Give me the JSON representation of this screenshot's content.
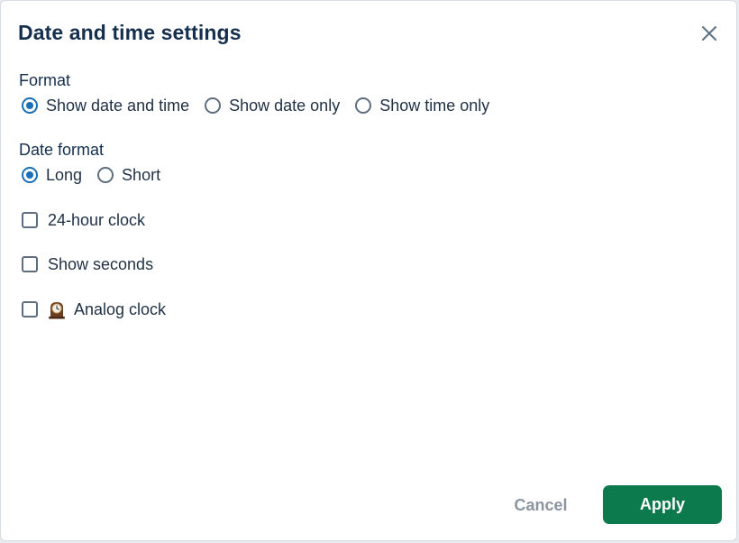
{
  "dialog": {
    "title": "Date and time settings",
    "close_icon": "close-icon"
  },
  "format": {
    "label": "Format",
    "options": [
      {
        "label": "Show date and time",
        "checked": true
      },
      {
        "label": "Show date only",
        "checked": false
      },
      {
        "label": "Show time only",
        "checked": false
      }
    ]
  },
  "date_format": {
    "label": "Date format",
    "options": [
      {
        "label": "Long",
        "checked": true
      },
      {
        "label": "Short",
        "checked": false
      }
    ]
  },
  "checkboxes": {
    "hour24": {
      "label": "24-hour clock",
      "checked": false
    },
    "seconds": {
      "label": "Show seconds",
      "checked": false
    },
    "analog": {
      "label": "Analog clock",
      "checked": false,
      "icon": "mantelpiece-clock-icon"
    }
  },
  "footer": {
    "cancel_label": "Cancel",
    "apply_label": "Apply"
  },
  "colors": {
    "accent": "#1a6fb5",
    "primary_button": "#0d7a4e",
    "title": "#152f4e"
  }
}
